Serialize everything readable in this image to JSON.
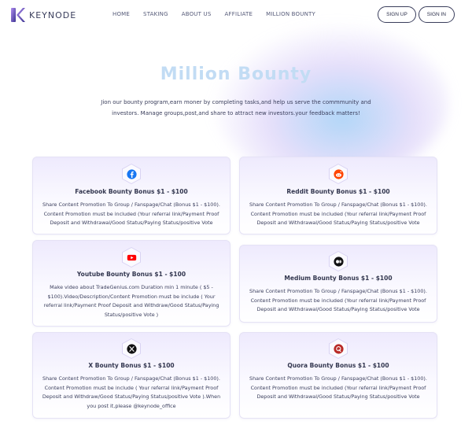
{
  "brand": {
    "name": "KEYNODE",
    "accent": "#8a6fe0",
    "accent_dark": "#4a3ea8"
  },
  "nav": {
    "links": [
      "HOME",
      "STAKING",
      "ABOUT US",
      "AFFILIATE",
      "MILLION BOUNTY"
    ],
    "signup": "SIGN UP",
    "signin": "SIGN IN"
  },
  "hero": {
    "title": "Million Bounty",
    "description": "Jion our bounty program,earn moner by completing tasks,and help us serve the commmunity and investors. Manage groups,post,and share to attract new investors.your feedback matters!"
  },
  "cards": [
    {
      "icon": "facebook-icon",
      "title": "Facebook Bounty Bonus $1 - $100",
      "desc": "Share Content Promotion To Group / Fanspage/Chat (Bonus $1 - $100). Content Promotion must be included (Your referral link/Payment Proof Deposit and Withdrawal/Good Status/Paying Status/positive Vote"
    },
    {
      "icon": "reddit-icon",
      "title": "Reddit Bounty Bonus $1 - $100",
      "desc": "Share Content Promotion To Group / Fanspage/Chat (Bonus $1 - $100). Content Promotion must be included (Your referral link/Payment Proof Deposit and Withdrawal/Good Status/Paying Status/positive Vote"
    },
    {
      "icon": "youtube-icon",
      "title": "Youtube Bounty Bonus $1 - $100",
      "desc": "Make video about TradeGenius.com Duration min 1 minute ( $5 - $100).Video/Description/Content Promotion must be include ( Your referral link/Payment Proof Deposit and Withdraw/Good Status/Paying Status/positive Vote )"
    },
    {
      "icon": "medium-icon",
      "title": "Medium Bounty Bonus $1 - $100",
      "desc": "Share Content Promotion To Group / Fanspage/Chat (Bonus $1 - $100). Content Promotion must be included (Your referral link/Payment Proof Deposit and Withdrawal/Good Status/Paying Status/positive Vote"
    },
    {
      "icon": "x-icon",
      "title": "X Bounty Bonus $1 - $100",
      "desc": "Share Content Promotion To Group / Fanspage/Chat (Bonus $1 - $100). Content Promotion must be include ( Your referral link/Payment Proof Deposit and Withdraw/Good Status/Paying Status/positive Vote ).When you post it,please @keynode_office"
    },
    {
      "icon": "quora-icon",
      "title": "Quora Bounty Bonus $1 - $100",
      "desc": "Share Content Promotion To Group / Fanspage/Chat (Bonus $1 - $100). Content Promotion must be included (Your referral link/Payment Proof Deposit and Withdrawal/Good Status/Paying Status/positive Vote"
    }
  ]
}
